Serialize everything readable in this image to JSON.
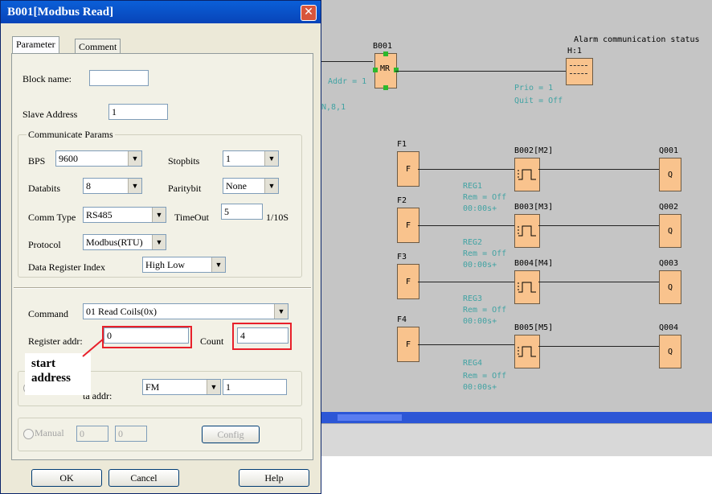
{
  "dialog": {
    "title": "B001[Modbus Read]",
    "close_label": "✕",
    "tabs": [
      "Parameter",
      "Comment"
    ],
    "block_name_label": "Block name:",
    "block_name_value": "",
    "slave_address_label": "Slave Address",
    "slave_address_value": "1",
    "comm_group_title": "Communicate Params",
    "bps_label": "BPS",
    "bps_value": "9600",
    "stopbits_label": "Stopbits",
    "stopbits_value": "1",
    "databits_label": "Databits",
    "databits_value": "8",
    "paritybit_label": "Paritybit",
    "paritybit_value": "None",
    "comm_type_label": "Comm Type",
    "comm_type_value": "RS485",
    "timeout_label": "TimeOut",
    "timeout_value": "5",
    "timeout_unit": "1/10S",
    "protocol_label": "Protocol",
    "protocol_value": "Modbus(RTU)",
    "data_reg_index_label": "Data Register Index",
    "data_reg_index_value": "High Low",
    "command_label": "Command",
    "command_value": "01 Read Coils(0x)",
    "register_addr_label": "Register addr:",
    "register_addr_value": "0",
    "count_label": "Count",
    "count_value": "4",
    "data_addr_label": "ta addr:",
    "data_addr_type": "FM",
    "data_addr_value": "1",
    "manual_label": "Manual",
    "manual_value_1": "0",
    "manual_value_2": "0",
    "config_label": "Config",
    "ok_label": "OK",
    "cancel_label": "Cancel",
    "help_label": "Help",
    "callout_line1": "start",
    "callout_line2": "address"
  },
  "diagram": {
    "b001_label": "B001",
    "mr_label": "MR",
    "addr_label": "Addr = 1",
    "n81_label": "N,8,1",
    "alarm_label": "Alarm communication status",
    "h1_label": "H:1",
    "prio_label": "Prio = 1",
    "quit_label": "Quit = Off",
    "rows": [
      {
        "f": "F1",
        "f_text": "F",
        "block": "B002[M2]",
        "reg": "REG1",
        "rem": "Rem = Off",
        "time": "00:00s+",
        "q": "Q001",
        "q_text": "Q"
      },
      {
        "f": "F2",
        "f_text": "F",
        "block": "B003[M3]",
        "reg": "REG2",
        "rem": "Rem = Off",
        "time": "00:00s+",
        "q": "Q002",
        "q_text": "Q"
      },
      {
        "f": "F3",
        "f_text": "F",
        "block": "B004[M4]",
        "reg": "REG3",
        "rem": "Rem = Off",
        "time": "00:00s+",
        "q": "Q003",
        "q_text": "Q"
      },
      {
        "f": "F4",
        "f_text": "F",
        "block": "B005[M5]",
        "reg": "REG4",
        "rem": "Rem = Off",
        "time": "00:00s+",
        "q": "Q004",
        "q_text": "Q"
      }
    ]
  },
  "colors": {
    "block_fill": "#f9c38d",
    "canvas_bg": "#c5c5c5",
    "annotation_teal": "#41a3a3",
    "highlight_red": "#e8202a",
    "titlebar_blue": "#0a5fd8"
  }
}
